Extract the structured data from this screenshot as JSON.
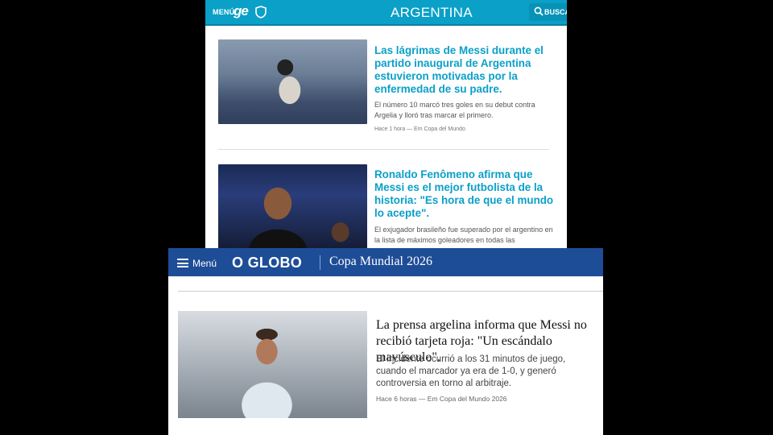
{
  "ge": {
    "header": {
      "menu_label": "MENÚ",
      "logo_text": "ge",
      "section_title": "ARGENTINA",
      "search_label": "BUSCAR",
      "icons": [
        "shield-icon",
        "search-icon"
      ],
      "brand_color": "#0aa0c8"
    },
    "articles": [
      {
        "title": "Las lágrimas de Messi durante el partido inaugural de Argentina estuvieron motivadas por la enfermedad de su padre.",
        "summary": "El número 10 marcó tres goles en su debut contra Argelia y lloró tras marcar el primero.",
        "meta": "Hace 1 hora   — Em Copa del Mundo"
      },
      {
        "title": "Ronaldo Fenômeno afirma que Messi es el mejor futbolista de la historia: \"Es hora de que el mundo lo acepte\".",
        "summary": "El exjugador brasileño fue superado por el argentino en la lista de máximos goleadores en todas las"
      }
    ]
  },
  "oglobo": {
    "header": {
      "menu_label": "Menú",
      "logo_text": "O GLOBO",
      "section_title": "Copa Mundial 2026",
      "icons": [
        "menu-icon"
      ],
      "brand_color": "#1e4d97"
    },
    "article": {
      "title": "La prensa argelina informa que Messi no recibió tarjeta roja: \"Un escándalo mayúsculo\".",
      "summary": "El incidente ocurrió a los 31 minutos de juego, cuando el marcador ya era de 1-0, y generó controversia en torno al arbitraje.",
      "meta": "Hace 6 horas   — Em Copa del Mundo 2026"
    }
  }
}
